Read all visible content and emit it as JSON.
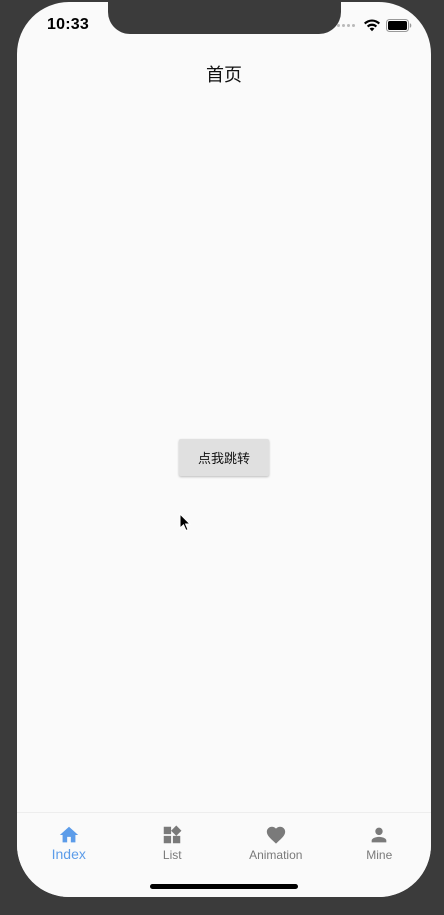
{
  "status_bar": {
    "time": "10:33"
  },
  "header": {
    "title": "首页"
  },
  "main": {
    "jump_button_label": "点我跳转"
  },
  "tab_bar": {
    "active_color": "#5c9ce9",
    "inactive_color": "#7a7a7a",
    "items": [
      {
        "label": "Index",
        "icon": "home-icon"
      },
      {
        "label": "List",
        "icon": "widgets-icon"
      },
      {
        "label": "Animation",
        "icon": "heart-icon"
      },
      {
        "label": "Mine",
        "icon": "person-icon"
      }
    ]
  }
}
